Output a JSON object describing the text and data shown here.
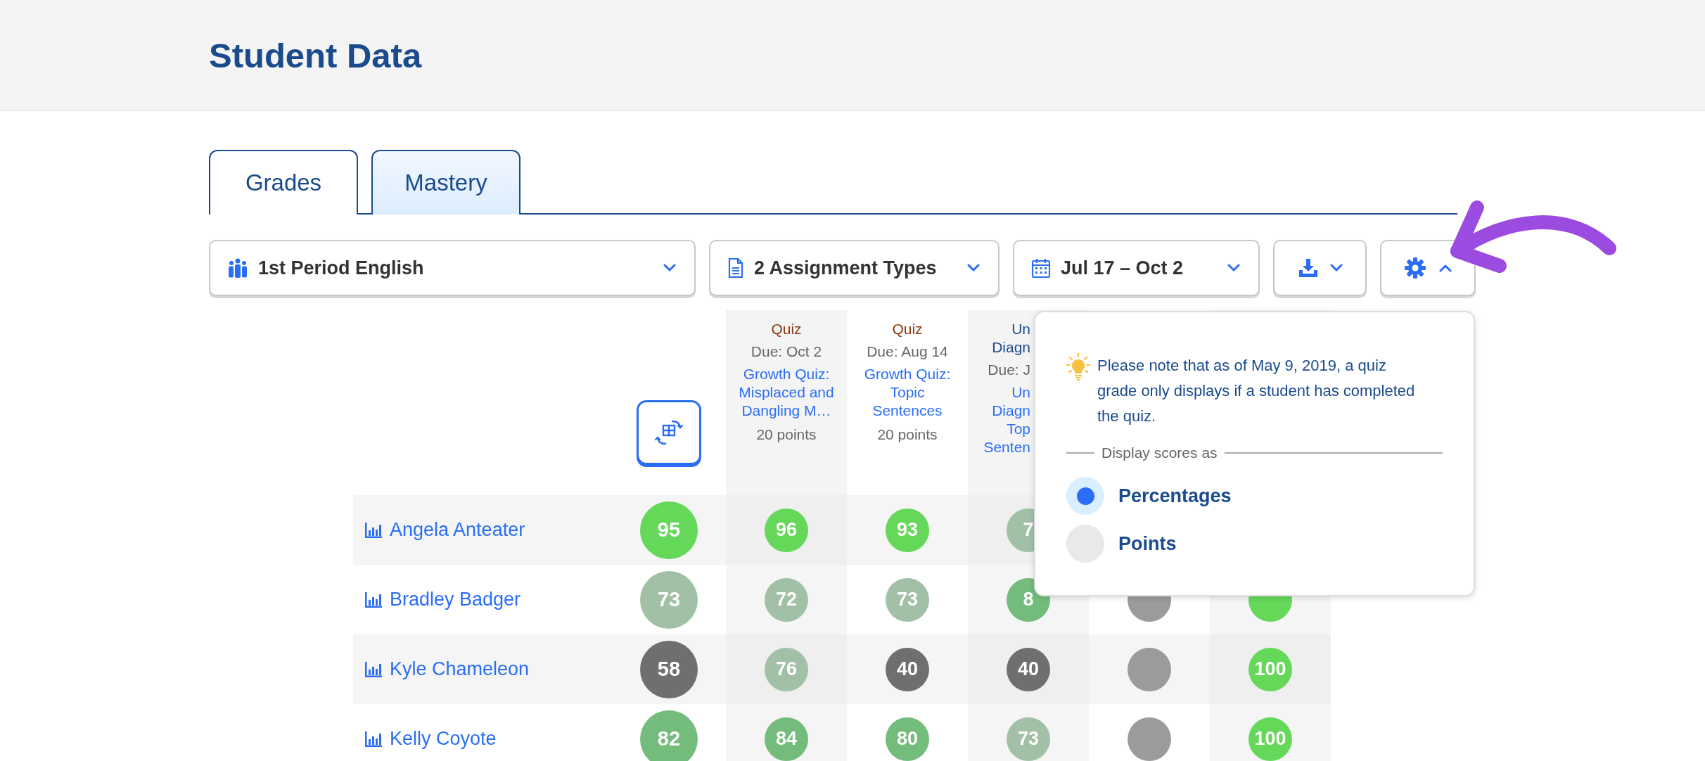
{
  "page_title": "Student Data",
  "tabs": [
    {
      "label": "Grades",
      "selected": true
    },
    {
      "label": "Mastery",
      "selected": false
    }
  ],
  "filters": [
    {
      "kind": "class",
      "label": "1st Period English",
      "expanded": false
    },
    {
      "kind": "types",
      "label": "2 Assignment Types",
      "expanded": false
    },
    {
      "kind": "dates",
      "label": "Jul 17 – Oct 2",
      "expanded": false
    },
    {
      "kind": "download",
      "expanded": false
    },
    {
      "kind": "settings",
      "expanded": true
    }
  ],
  "assignments": [
    {
      "kind": "quiz",
      "type_label": "Quiz",
      "due": "Due: Oct 2",
      "title": "Growth Quiz: Misplaced and Dangling M…",
      "points": "20 points"
    },
    {
      "kind": "quiz",
      "type_label": "Quiz",
      "due": "Due: Aug 14",
      "title": "Growth Quiz: Topic Sentences",
      "points": "20 points"
    },
    {
      "kind": "unit",
      "type_label": "Un Diagn",
      "due": "Due: J",
      "title": "Un Diagn Top Senten"
    }
  ],
  "students": [
    {
      "name": "Angela Anteater",
      "overall": {
        "score": "95",
        "color": "#65d85a"
      },
      "cells": [
        {
          "score": "96",
          "color": "#65d85a"
        },
        {
          "score": "93",
          "color": "#65d85a"
        },
        {
          "score": "7",
          "color": "#a1c0a6"
        },
        null,
        null
      ]
    },
    {
      "name": "Bradley Badger",
      "overall": {
        "score": "73",
        "color": "#a1c0a6"
      },
      "cells": [
        {
          "score": "72",
          "color": "#a1c0a6"
        },
        {
          "score": "73",
          "color": "#a1c0a6"
        },
        {
          "score": "8",
          "color": "#74bc7c"
        },
        {
          "color": "#9b9b9b"
        },
        {
          "color": "#65d85a"
        }
      ]
    },
    {
      "name": "Kyle Chameleon",
      "overall": {
        "score": "58",
        "color": "#6f6f6f"
      },
      "cells": [
        {
          "score": "76",
          "color": "#a1c0a6"
        },
        {
          "score": "40",
          "color": "#6f6f6f"
        },
        {
          "score": "40",
          "color": "#6f6f6f"
        },
        {
          "color": "#9b9b9b"
        },
        {
          "score": "100",
          "color": "#65d85a"
        }
      ]
    },
    {
      "name": "Kelly Coyote",
      "overall": {
        "score": "82",
        "color": "#74bc7c"
      },
      "cells": [
        {
          "score": "84",
          "color": "#74bc7c"
        },
        {
          "score": "80",
          "color": "#74bc7c"
        },
        {
          "score": "73",
          "color": "#a1c0a6"
        },
        {
          "color": "#9b9b9b"
        },
        {
          "score": "100",
          "color": "#65d85a"
        }
      ]
    }
  ],
  "settings_popover": {
    "note": "Please note that as of May 9, 2019, a quiz grade only displays if a student has completed the quiz.",
    "legend": "Display scores as",
    "options": [
      {
        "label": "Percentages",
        "selected": true
      },
      {
        "label": "Points",
        "selected": false
      }
    ]
  }
}
